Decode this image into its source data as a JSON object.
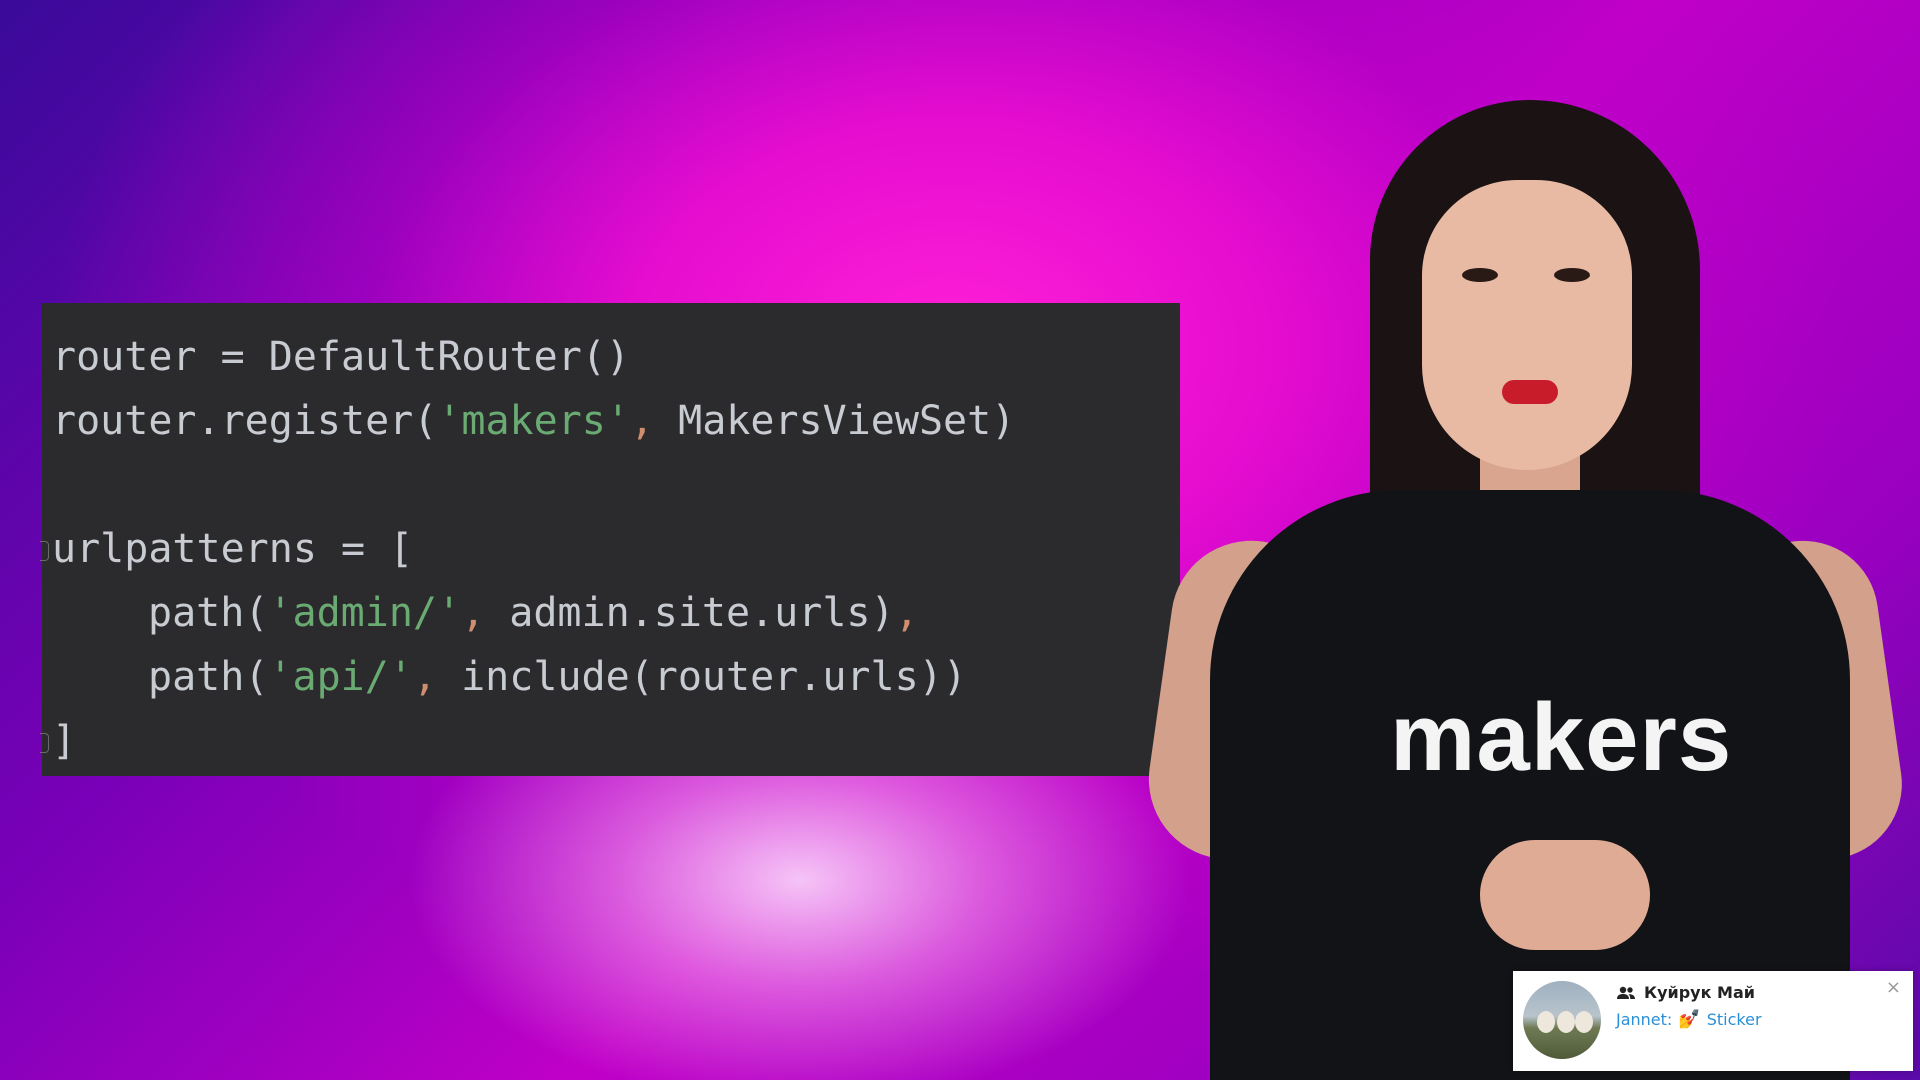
{
  "code": {
    "lines": [
      {
        "a": "router = DefaultRouter()"
      },
      {
        "a": "router.register(",
        "s1": "'makers'",
        "p1": ",",
        "b": " MakersViewSet)"
      },
      {
        "a": ""
      },
      {
        "a": "urlpatterns = ["
      },
      {
        "a": "path(",
        "s1": "'admin/'",
        "p1": ",",
        "b": " admin.site.urls)",
        "p2": ","
      },
      {
        "a": "path(",
        "s1": "'api/'",
        "p1": ",",
        "b": " include(router.urls))"
      },
      {
        "a": "]"
      }
    ]
  },
  "presenter": {
    "shirt_text": "makers"
  },
  "notification": {
    "title": "Куйрук Май",
    "sender": "Jannet:",
    "sticker_emoji": "💅",
    "message": "Sticker",
    "close_glyph": "×",
    "avatar": "sheep-photo"
  },
  "colors": {
    "code_bg": "#2b2b2d",
    "code_text": "#c8ccd2",
    "string": "#6aab73",
    "punctuation": "#cf8e6d",
    "link": "#2a8fd8"
  }
}
